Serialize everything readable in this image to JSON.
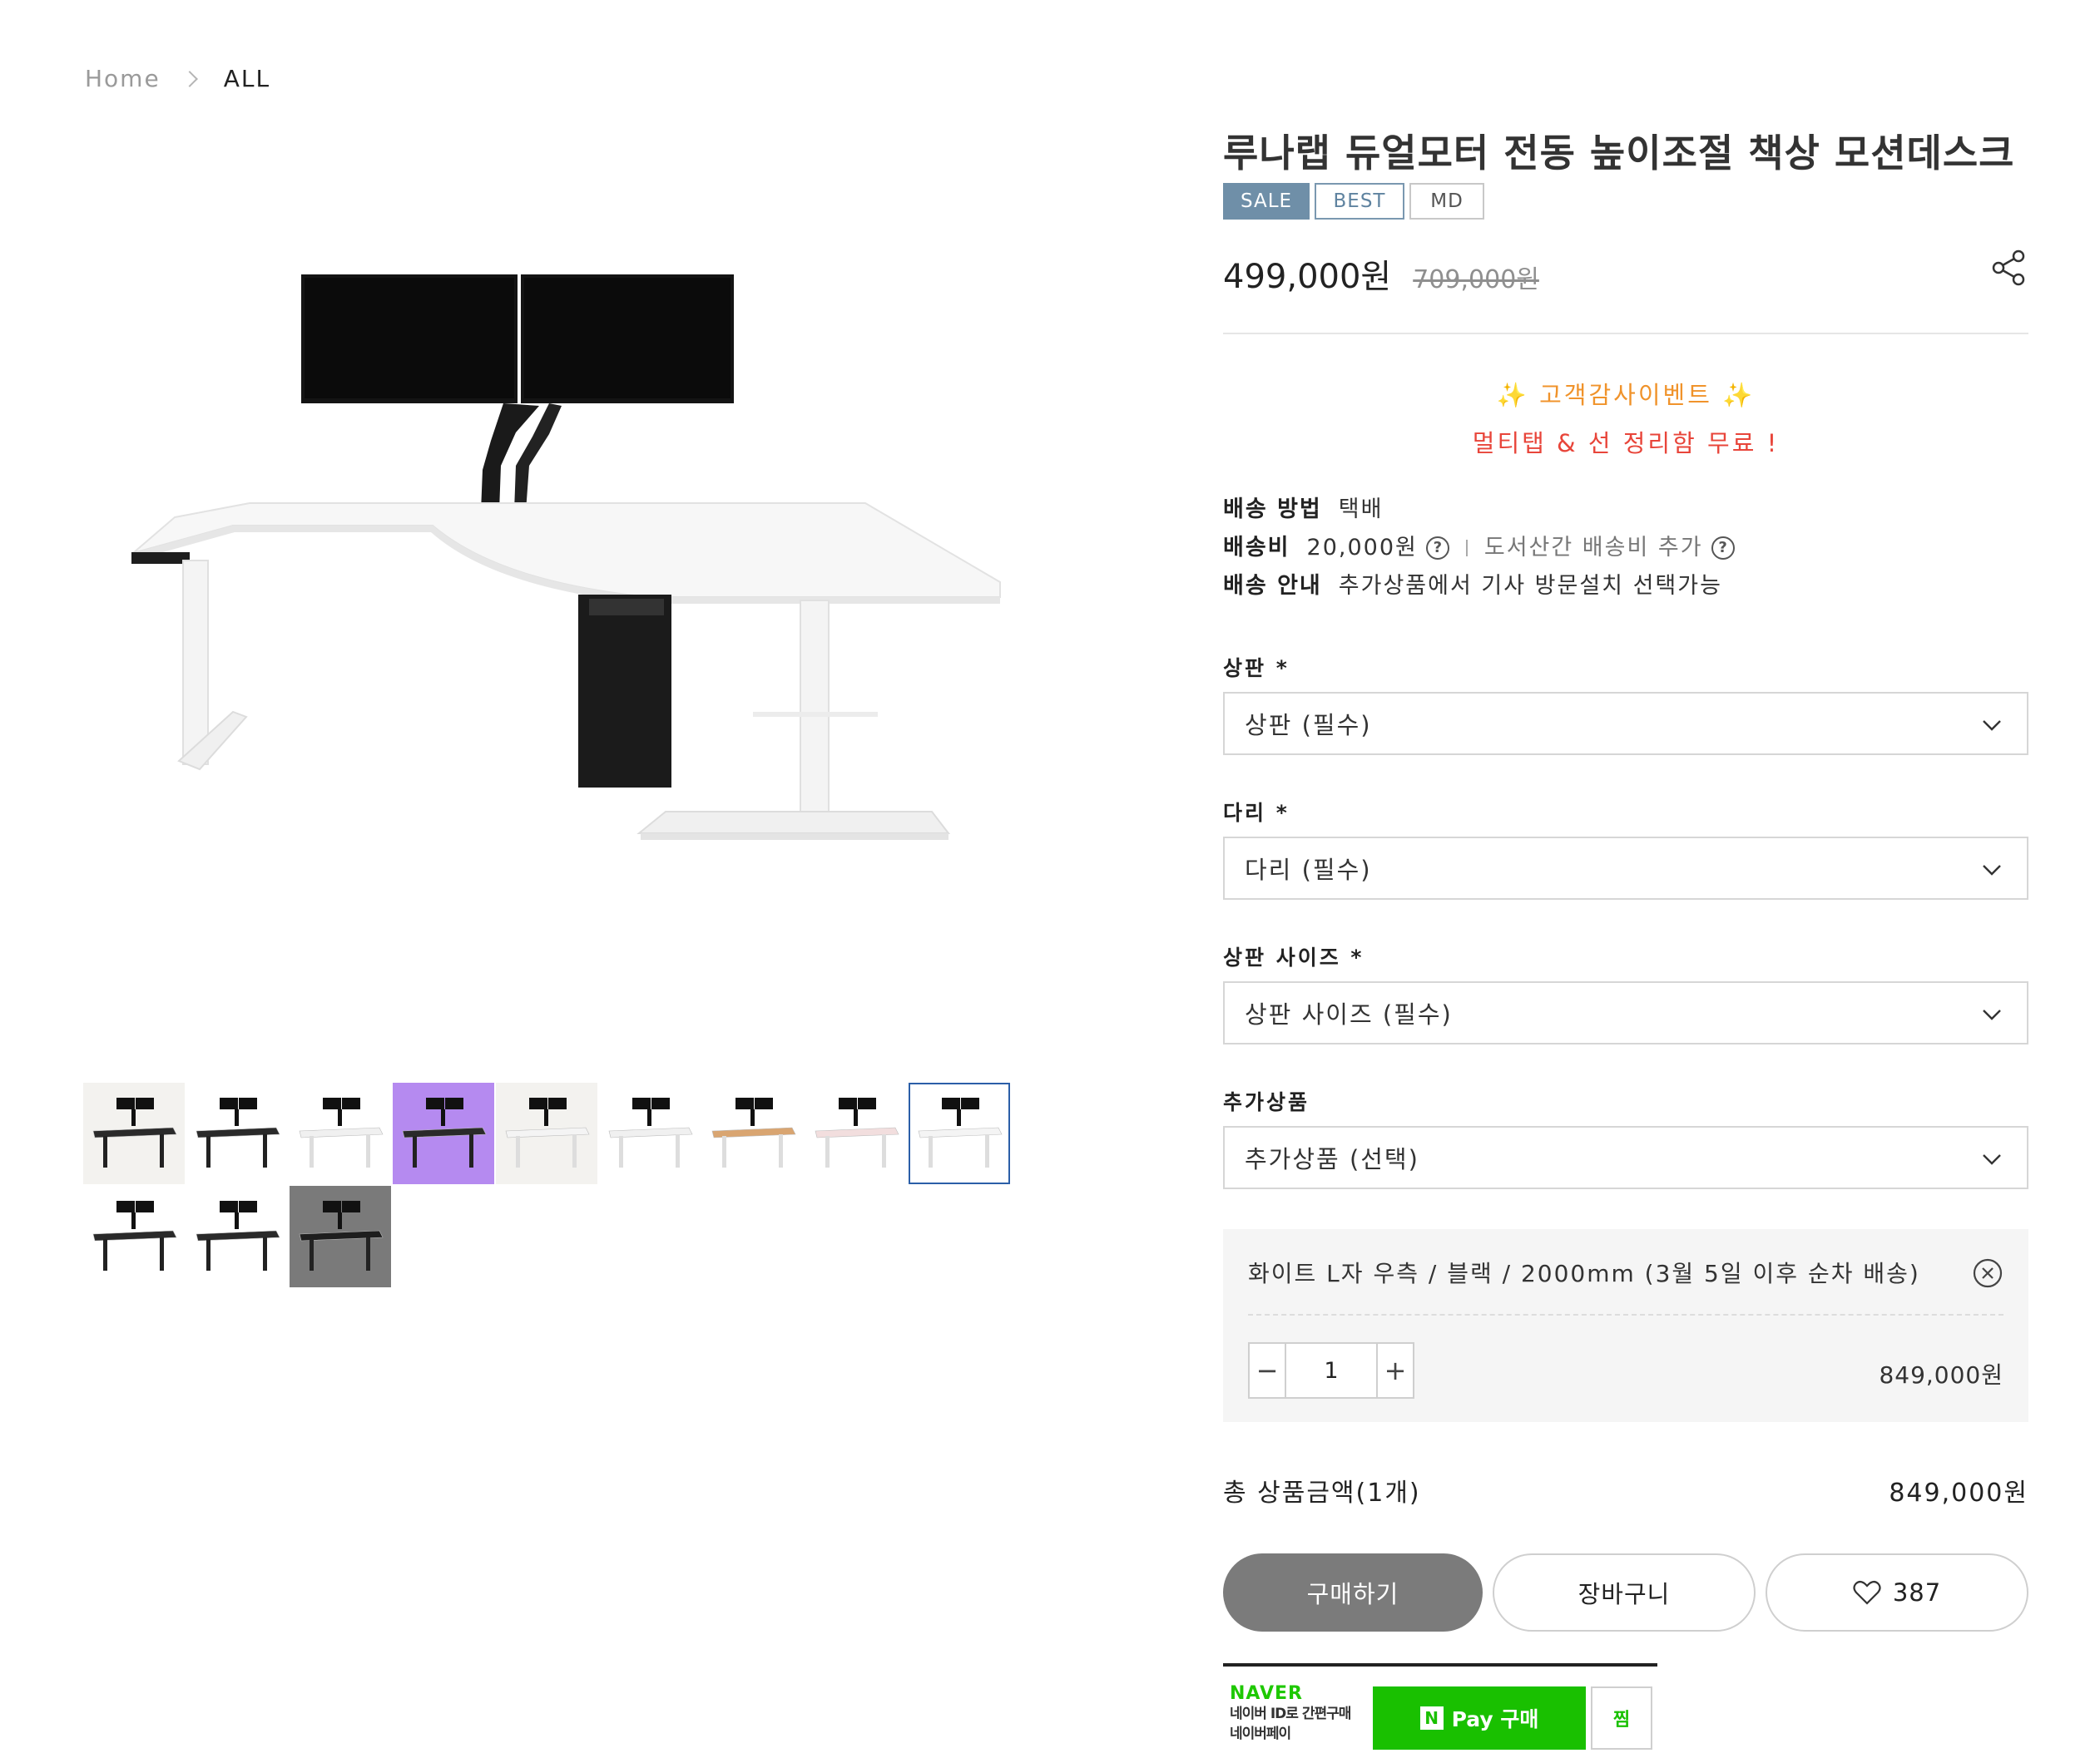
{
  "breadcrumb": {
    "home": "Home",
    "current": "ALL"
  },
  "product": {
    "title": "루나랩 듀얼모터 전동 높이조절 책상 모션데스크",
    "badges": {
      "sale": "SALE",
      "best": "BEST",
      "md": "MD"
    },
    "price": "499,000원",
    "original_price": "709,000원"
  },
  "event": {
    "line1": "✨ 고객감사이벤트 ✨",
    "line2": "멀티탭 & 선 정리함 무료 !"
  },
  "shipping": {
    "method_label": "배송 방법",
    "method_value": "택배",
    "fee_label": "배송비",
    "fee_value": "20,000원",
    "remote_note": "도서산간 배송비 추가",
    "info_label": "배송 안내",
    "info_value": "추가상품에서 기사 방문설치 선택가능",
    "help_glyph": "?"
  },
  "options": {
    "top": {
      "label": "상판 *",
      "value": "상판 (필수)"
    },
    "leg": {
      "label": "다리 *",
      "value": "다리 (필수)"
    },
    "size": {
      "label": "상판 사이즈 *",
      "value": "상판 사이즈 (필수)"
    },
    "addon": {
      "label": "추가상품",
      "value": "추가상품 (선택)"
    }
  },
  "selected_item": {
    "name": "화이트 L자 우측 / 블랙 / 2000mm (3월 5일 이후 순차 배송)",
    "quantity": "1",
    "minus": "−",
    "plus": "+",
    "price": "849,000원"
  },
  "total": {
    "label": "총 상품금액(1개)",
    "value": "849,000원"
  },
  "actions": {
    "buy": "구매하기",
    "cart": "장바구니",
    "like_count": "387"
  },
  "naver_pay": {
    "brand": "NAVER",
    "desc1": "네이버 ID로 간편구매",
    "desc2": "네이버페이",
    "n": "N",
    "button": "Pay 구매",
    "wish": "찜",
    "color": "#19c000"
  },
  "thumbnails": [
    {
      "bg": "#f3f2ef",
      "desk": "#2a2a2a"
    },
    {
      "bg": "#ffffff",
      "desk": "#2a2a2a"
    },
    {
      "bg": "#ffffff",
      "desk": "#f0f0f0"
    },
    {
      "bg": "#b58af0",
      "desk": "#2a2a2a"
    },
    {
      "bg": "#f3f2ef",
      "desk": "#f4f4f4"
    },
    {
      "bg": "#ffffff",
      "desk": "#f0f0f0"
    },
    {
      "bg": "#ffffff",
      "desk": "#d9a571"
    },
    {
      "bg": "#ffffff",
      "desk": "#f2dede"
    },
    {
      "bg": "#ffffff",
      "desk": "#f4f4f4"
    },
    {
      "bg": "#ffffff",
      "desk": "#2a2a2a"
    },
    {
      "bg": "#ffffff",
      "desk": "#2a2a2a"
    },
    {
      "bg": "#7a7a7a",
      "desk": "#1e1e1e"
    }
  ],
  "active_thumbnail": 8
}
